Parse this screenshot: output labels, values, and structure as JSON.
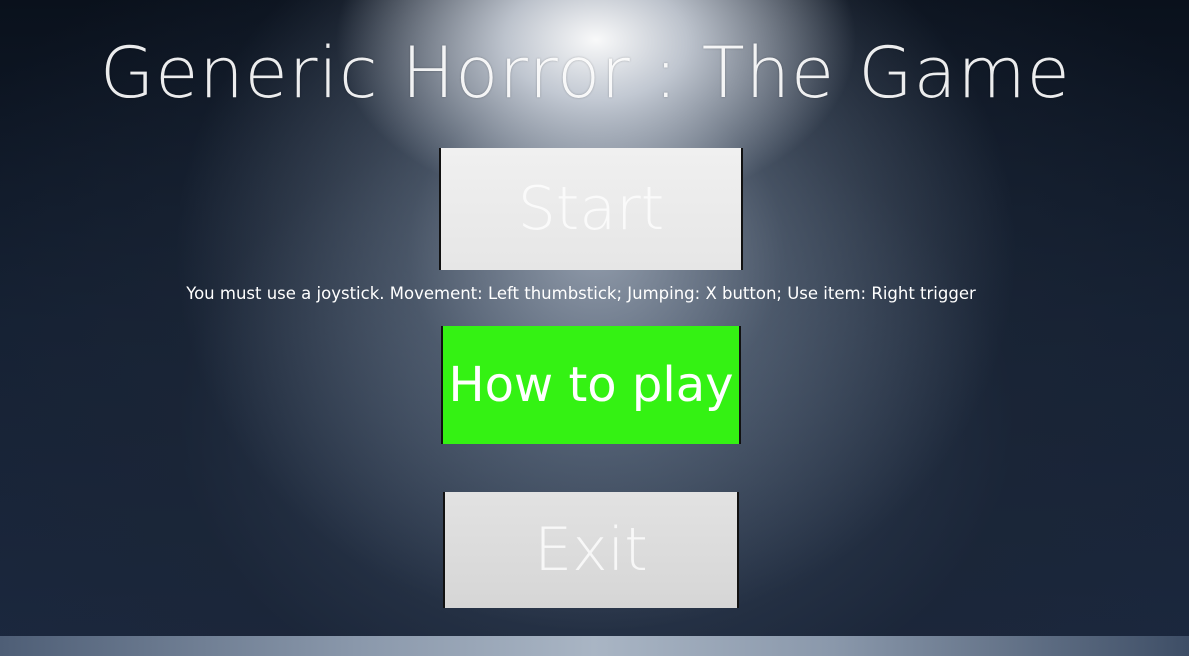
{
  "title": "Generic Horror : The Game",
  "menu": {
    "start_label": "Start",
    "how_to_play_label": "How to play",
    "exit_label": "Exit"
  },
  "instructions": "You must use a joystick. Movement: Left thumbstick; Jumping: X button; Use item: Right trigger",
  "colors": {
    "highlight_button": "#34f213",
    "inactive_button": "#e6e6e6",
    "background": "#142033"
  }
}
